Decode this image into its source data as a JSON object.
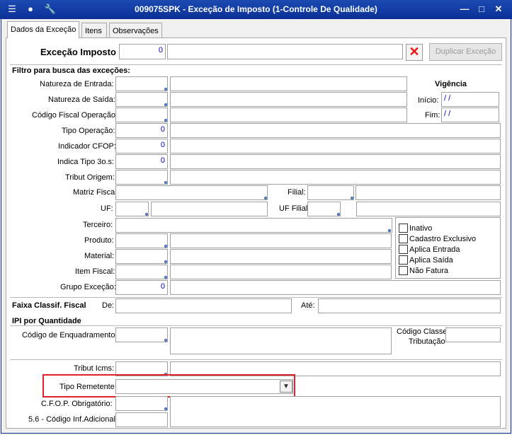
{
  "window": {
    "title": "009075SPK - Exceção de Imposto (1-Controle De Qualidade)",
    "icons": [
      "menu-icon",
      "traffic-light-icon",
      "wrench-icon"
    ],
    "controls": [
      "minimize-icon",
      "maximize-icon",
      "close-icon"
    ]
  },
  "tabs": [
    {
      "label": "Dados da Exceção",
      "active": true
    },
    {
      "label": "Itens"
    },
    {
      "label": "Observações"
    }
  ],
  "header": {
    "label": "Exceção Imposto",
    "code": "0",
    "description": "",
    "duplicate_button": "Duplicar Exceção"
  },
  "filter": {
    "title": "Filtro para busca das exceções:",
    "natureza_entrada": {
      "label": "Natureza de Entrada:",
      "value": "",
      "desc": ""
    },
    "natureza_saida": {
      "label": "Natureza de Saída:",
      "value": "",
      "desc": ""
    },
    "codigo_fiscal": {
      "label": "Código Fiscal Operação:",
      "value": "",
      "desc": ""
    },
    "tipo_operacao": {
      "label": "Tipo Operação:",
      "value": "0",
      "desc": ""
    },
    "indicador_cfop": {
      "label": "Indicador CFOP:",
      "value": "0",
      "desc": ""
    },
    "indica_tipo": {
      "label": "Indica Tipo 3o.s:",
      "value": "0",
      "desc": ""
    },
    "tribut_origem": {
      "label": "Tribut Origem:",
      "value": "",
      "desc": ""
    },
    "matriz_fiscal": {
      "label": "Matriz Fiscal",
      "value": ""
    },
    "filial": {
      "label": "Filial:",
      "value": "",
      "desc": ""
    },
    "uf": {
      "label": "UF:",
      "value": "",
      "desc": ""
    },
    "uf_filial": {
      "label": "UF Filial",
      "value": "",
      "desc": ""
    },
    "terceiro": {
      "label": "Terceiro:",
      "value": ""
    },
    "produto": {
      "label": "Produto:",
      "value": "",
      "desc": ""
    },
    "material": {
      "label": "Material:",
      "value": "",
      "desc": ""
    },
    "item_fiscal": {
      "label": "Item Fiscal:",
      "value": "",
      "desc": ""
    },
    "grupo_excecao": {
      "label": "Grupo Exceção:",
      "value": "0",
      "desc": ""
    }
  },
  "vigencia": {
    "title": "Vigência",
    "inicio_label": "Início:",
    "inicio_value": "/ /",
    "fim_label": "Fim:",
    "fim_value": "/ /"
  },
  "checkboxes": [
    {
      "label": "Inativo",
      "checked": false
    },
    {
      "label": "Cadastro Exclusivo",
      "checked": false
    },
    {
      "label": "Aplica Entrada",
      "checked": false
    },
    {
      "label": "Aplica Saída",
      "checked": false
    },
    {
      "label": "Não Fatura",
      "checked": false
    }
  ],
  "faixa": {
    "title": "Faixa Classif. Fiscal",
    "de_label": "De:",
    "de_value": "",
    "ate_label": "Até:",
    "ate_value": ""
  },
  "ipi": {
    "title": "IPI por Quantidade",
    "enquadramento_label": "Código de Enquadramento:",
    "enquadramento_value": "",
    "enquadramento_desc": "",
    "classe_label_1": "Código Classe",
    "classe_label_2": "Tributação",
    "classe_value": ""
  },
  "bottom": {
    "tribut_icms": {
      "label": "Tribut Icms:",
      "value": "",
      "desc": ""
    },
    "tipo_remetente": {
      "label": "Tipo Remetente",
      "value": ""
    },
    "cfop_obrigatorio": {
      "label": "C.F.O.P. Obrigatório:",
      "value": "",
      "desc": ""
    },
    "codigo_inf_adicional": {
      "label": "5.6 - Código Inf.Adicional",
      "value": ""
    }
  },
  "colors": {
    "titlebar": "#0b2f95",
    "value_text": "#0000c8",
    "highlight": "#e0202a",
    "delete_x": "#e11111"
  }
}
